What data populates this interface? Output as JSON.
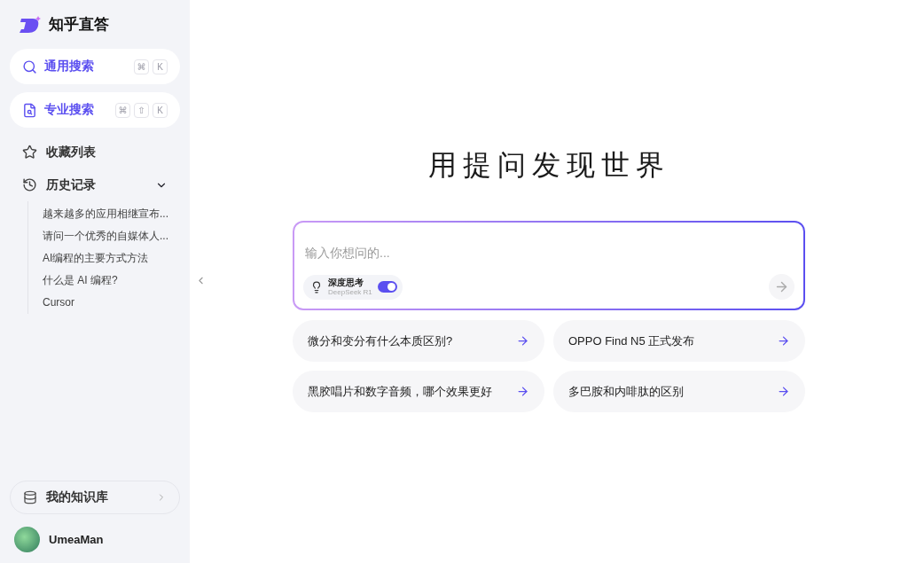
{
  "brand": {
    "name": "知乎直答"
  },
  "nav": [
    {
      "kind": "search",
      "label": "通用搜索",
      "keys": [
        "⌘",
        "K"
      ]
    },
    {
      "kind": "pro",
      "label": "专业搜索",
      "keys": [
        "⌘",
        "⇧",
        "K"
      ]
    }
  ],
  "menu": [
    {
      "kind": "star",
      "label": "收藏列表"
    },
    {
      "kind": "history",
      "label": "历史记录",
      "expanded": true,
      "children": [
        {
          "label": "越来越多的应用相继宣布..."
        },
        {
          "label": "请问一个优秀的自媒体人..."
        },
        {
          "label": "AI编程的主要方式方法"
        },
        {
          "label": "什么是 AI 编程?"
        },
        {
          "label": "Cursor"
        }
      ]
    }
  ],
  "knowledge_base": {
    "label": "我的知识库"
  },
  "user": {
    "name": "UmeaMan"
  },
  "headline": "用提问发现世界",
  "composer": {
    "placeholder": "输入你想问的...",
    "deep_think": {
      "title": "深度思考",
      "model": "DeepSeek R1",
      "on": true
    }
  },
  "suggestions": [
    {
      "label": "微分和变分有什么本质区别?"
    },
    {
      "label": "OPPO Find N5 正式发布"
    },
    {
      "label": "黑胶唱片和数字音频，哪个效果更好"
    },
    {
      "label": "多巴胺和内啡肽的区别"
    }
  ]
}
